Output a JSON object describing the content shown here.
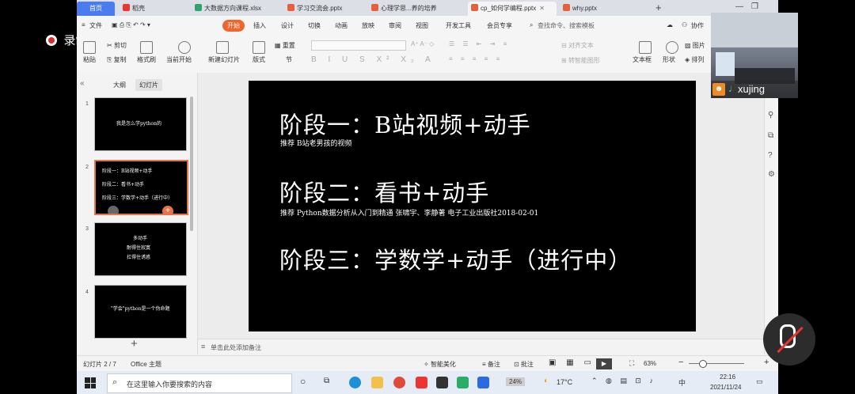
{
  "recording": {
    "label": "录制中"
  },
  "tabs": [
    {
      "label": "首页"
    },
    {
      "label": "稻壳"
    },
    {
      "label": "大数据方向课程.xlsx"
    },
    {
      "label": "学习交流会.pptx"
    },
    {
      "label": "心理学思...养的培养"
    },
    {
      "label": "cp_如何学编程.pptx"
    },
    {
      "label": "why.pptx"
    }
  ],
  "menu": {
    "file": "文件",
    "start": "开始",
    "items": [
      "插入",
      "设计",
      "切换",
      "动画",
      "放映",
      "审阅",
      "视图",
      "开发工具",
      "会员专享"
    ],
    "search": "查找命令、搜索模板",
    "collab": "协作"
  },
  "ribbon": {
    "paste": "粘贴",
    "cut": "剪切",
    "copy": "复制",
    "format_painter": "格式刷",
    "play_from_current": "当前开始",
    "new_slide": "新建幻灯片",
    "layout": "版式",
    "section": "节",
    "reset": "重置",
    "align_text": "对齐文本",
    "smartart": "转智能图形",
    "textbox": "文本框",
    "shape": "形状",
    "picture": "图片",
    "arrange": "排列"
  },
  "panel": {
    "outline": "大纲",
    "slides": "幻灯片"
  },
  "thumbnails": [
    {
      "num": "1",
      "lines": [
        "我是怎么学python的"
      ]
    },
    {
      "num": "2",
      "lines": [
        "阶段一：B站视频+动手",
        "阶段二：看书+动手",
        "阶段三：学数学+动手（进行中）"
      ]
    },
    {
      "num": "3",
      "lines": [
        "多动手",
        "耐得住寂寞",
        "扛得住诱惑"
      ]
    },
    {
      "num": "4",
      "lines": [
        "\"学会\"python是一个伪命题"
      ]
    }
  ],
  "slide": {
    "stage1_title": "阶段一：B站视频+动手",
    "stage1_sub": "推荐 B站老男孩的视频",
    "stage2_title": "阶段二：看书+动手",
    "stage2_sub": "推荐 Python数据分析从入门到精通 张啸宇、李静著 电子工业出版社2018-02-01",
    "stage3_title": "阶段三：学数学+动手（进行中）"
  },
  "notes": {
    "placeholder": "单击此处添加备注"
  },
  "status": {
    "slide_counter": "幻灯片 2 / 7",
    "theme": "Office 主题",
    "beautify": "智能美化",
    "notes": "备注",
    "comment": "批注",
    "zoom": "63%"
  },
  "taskbar": {
    "search_placeholder": "在这里输入你要搜索的内容",
    "battery": "24%",
    "weather": "17°C",
    "ime": "中",
    "time": "22:16",
    "date": "2021/11/24"
  },
  "video": {
    "name": "xujing"
  },
  "colors": {
    "accent": "#f0642d",
    "wps_blue": "#4a7cf0"
  }
}
